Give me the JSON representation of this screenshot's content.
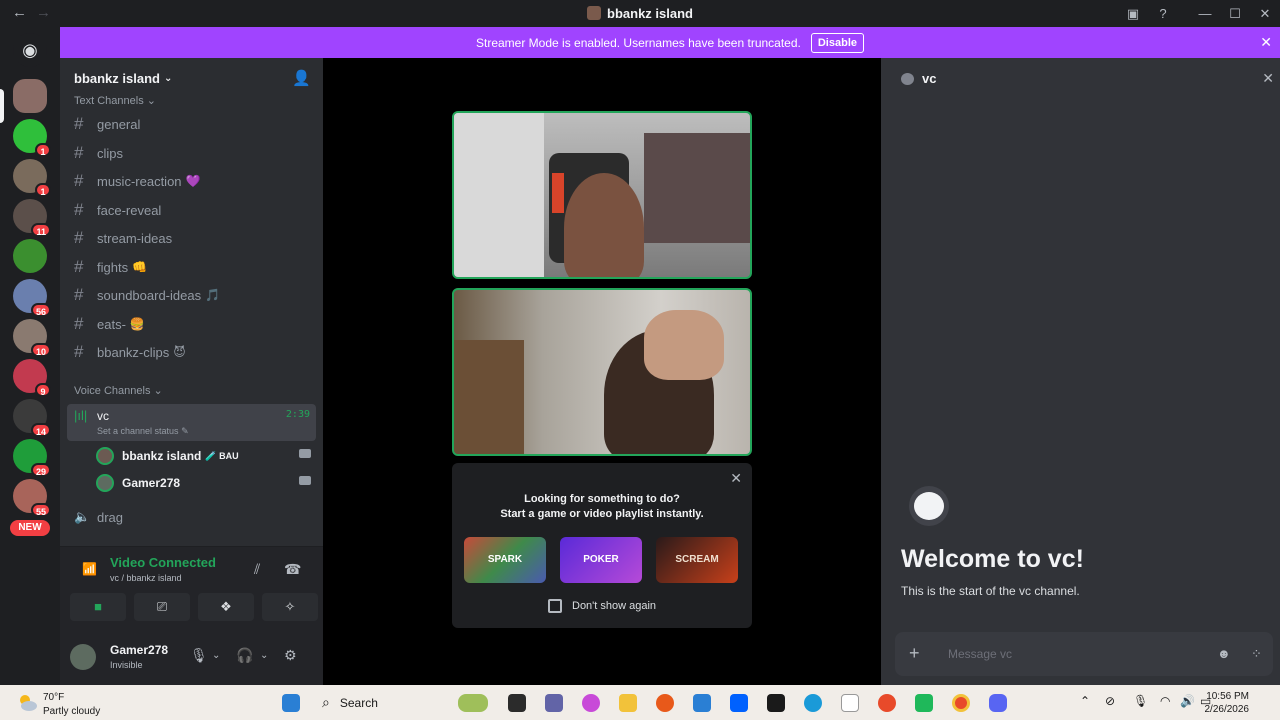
{
  "window": {
    "title": "bbankz island"
  },
  "banner": {
    "text": "Streamer Mode is enabled. Usernames have been truncated.",
    "disable_label": "Disable"
  },
  "guilds": {
    "badges": [
      "1",
      "1",
      "11",
      "56",
      "10",
      "9",
      "14",
      "29",
      "55"
    ],
    "new_label": "NEW"
  },
  "server": {
    "name": "bbankz island",
    "text_category": "Text Channels",
    "voice_category": "Voice Channels",
    "text_channels": [
      {
        "name": "general",
        "emoji": ""
      },
      {
        "name": "clips",
        "emoji": ""
      },
      {
        "name": "music-reaction",
        "emoji": "💜"
      },
      {
        "name": "face-reveal",
        "emoji": ""
      },
      {
        "name": "stream-ideas",
        "emoji": ""
      },
      {
        "name": "fights",
        "emoji": "👊"
      },
      {
        "name": "soundboard-ideas",
        "emoji": "🎵"
      },
      {
        "name": "eats-",
        "emoji": "🍔"
      },
      {
        "name": "bbankz-clips",
        "emoji": "😈"
      }
    ],
    "voice_channels": [
      {
        "name": "vc",
        "status": "Set a channel status",
        "time": "2:39",
        "members": [
          {
            "name": "bbankz island",
            "tag": "🧪 BAU"
          },
          {
            "name": "Gamer278",
            "tag": ""
          }
        ]
      },
      {
        "name": "drag"
      }
    ]
  },
  "voice_bar": {
    "title": "Video Connected",
    "sub": "vc / bbankz island"
  },
  "user": {
    "name": "Gamer278",
    "status": "Invisible"
  },
  "activity": {
    "line1": "Looking for something to do?",
    "line2": "Start a game or video playlist instantly.",
    "games": [
      "SPARK",
      "POKER",
      "SCREAM"
    ],
    "dont_show": "Don't show again"
  },
  "chat": {
    "channel": "vc",
    "welcome_title": "Welcome to vc!",
    "welcome_sub": "This is the start of the vc channel.",
    "placeholder": "Message vc"
  },
  "taskbar": {
    "temp": "70°F",
    "weather": "Partly cloudy",
    "search": "Search",
    "time": "10:56 PM",
    "date": "2/26/2026"
  },
  "colors": {
    "accent": "#a044ff",
    "online": "#23a55a",
    "badge": "#f23f43"
  }
}
